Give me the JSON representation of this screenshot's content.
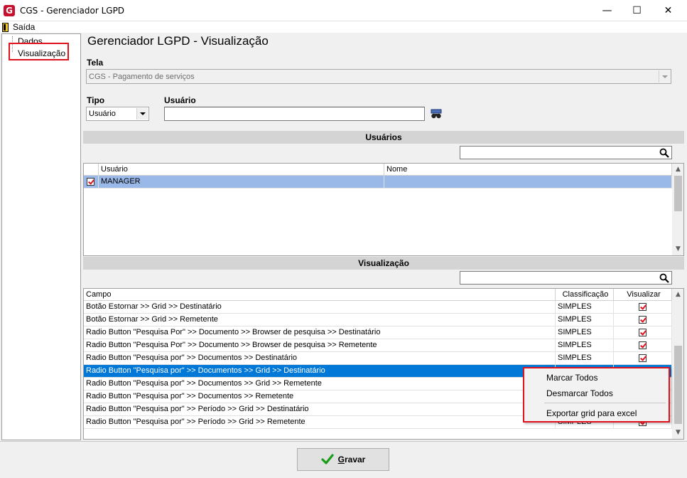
{
  "window": {
    "title": "CGS - Gerenciador LGPD",
    "logo_letter": "G",
    "minimize": "—",
    "maximize": "☐",
    "close": "✕"
  },
  "menu": {
    "exit_label": "Saída"
  },
  "sidebar": {
    "items": [
      {
        "label": "Dados"
      },
      {
        "label": "Visualização"
      }
    ]
  },
  "page": {
    "title": "Gerenciador LGPD - Visualização"
  },
  "form": {
    "tela_label": "Tela",
    "tela_value": "CGS - Pagamento de serviços",
    "tipo_label": "Tipo",
    "tipo_value": "Usuário",
    "usuario_label": "Usuário",
    "usuario_value": ""
  },
  "users_section": {
    "header": "Usuários",
    "columns": [
      "Usuário",
      "Nome"
    ],
    "rows": [
      {
        "usuario": "MANAGER",
        "nome": "",
        "checked": true
      }
    ]
  },
  "visual_section": {
    "header": "Visualização",
    "columns": [
      "Campo",
      "Classificação",
      "Visualizar"
    ],
    "rows": [
      {
        "campo": "Botão Estornar >> Grid >> Destinatário",
        "classificacao": "SIMPLES",
        "visualizar": true
      },
      {
        "campo": "Botão Estornar >> Grid >> Remetente",
        "classificacao": "SIMPLES",
        "visualizar": true
      },
      {
        "campo": "Radio Button \"Pesquisa Por\" >> Documento >> Browser de pesquisa >> Destinatário",
        "classificacao": "SIMPLES",
        "visualizar": true
      },
      {
        "campo": "Radio Button \"Pesquisa Por\" >> Documento >> Browser de pesquisa >> Remetente",
        "classificacao": "SIMPLES",
        "visualizar": true
      },
      {
        "campo": "Radio Button \"Pesquisa por\" >> Documentos >> Destinatário",
        "classificacao": "SIMPLES",
        "visualizar": true
      },
      {
        "campo": "Radio Button \"Pesquisa por\" >> Documentos >> Grid >> Destinatário",
        "classificacao": "",
        "visualizar": null
      },
      {
        "campo": "Radio Button \"Pesquisa por\" >> Documentos >> Grid >> Remetente",
        "classificacao": "",
        "visualizar": null
      },
      {
        "campo": "Radio Button \"Pesquisa por\" >> Documentos >> Remetente",
        "classificacao": "",
        "visualizar": null
      },
      {
        "campo": "Radio Button \"Pesquisa por\" >> Período >> Grid >> Destinatário",
        "classificacao": "",
        "visualizar": null
      },
      {
        "campo": "Radio Button \"Pesquisa por\" >> Período >> Grid >> Remetente",
        "classificacao": "SIMPLES",
        "visualizar": true
      }
    ]
  },
  "context_menu": {
    "items": [
      "Marcar Todos",
      "Desmarcar Todos",
      "Exportar grid para excel"
    ]
  },
  "footer": {
    "save_accel": "G",
    "save_rest": "ravar"
  },
  "colors": {
    "selection": "#0078d7",
    "accent_red": "#e0121d",
    "check_green": "#1a9e1a"
  }
}
